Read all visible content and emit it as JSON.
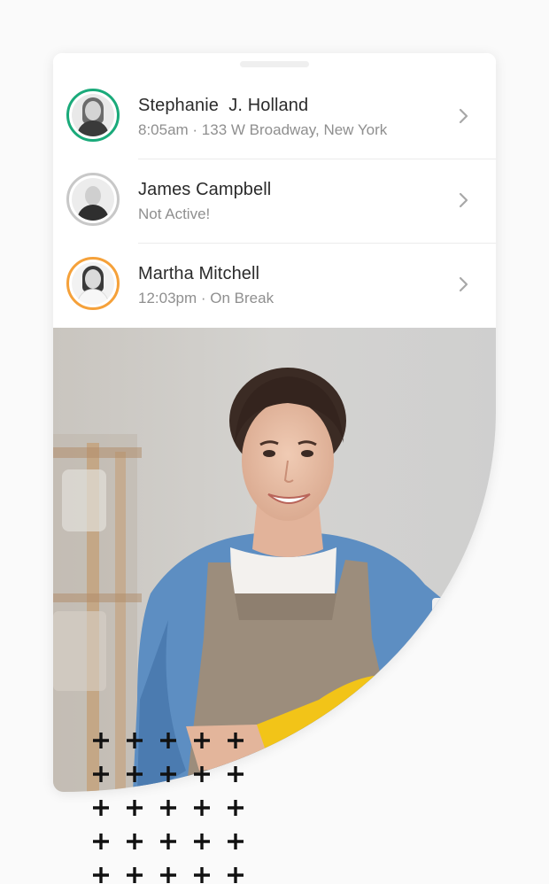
{
  "employees": [
    {
      "name": "Stephanie  J. Holland",
      "detail": "8:05am · 133 W Broadway, New York",
      "status_color": "#1aaa7a",
      "avatar_icon": "woman-portrait-icon"
    },
    {
      "name": "James Campbell",
      "detail": "Not Active!",
      "status_color": "#c8c8c8",
      "avatar_icon": "man-portrait-icon"
    },
    {
      "name": "Martha Mitchell",
      "detail": "12:03pm · On Break",
      "status_color": "#f5a13a",
      "avatar_icon": "woman-portrait-icon"
    }
  ],
  "hero": {
    "description_icon": "cleaning-worker-photo",
    "glove_color": "#f2c418",
    "shirt_color": "#5d8ec2",
    "apron_color": "#9c8d7c"
  },
  "decoration": {
    "icon": "plus-pattern-icon",
    "rows": 5,
    "cols": 5
  }
}
